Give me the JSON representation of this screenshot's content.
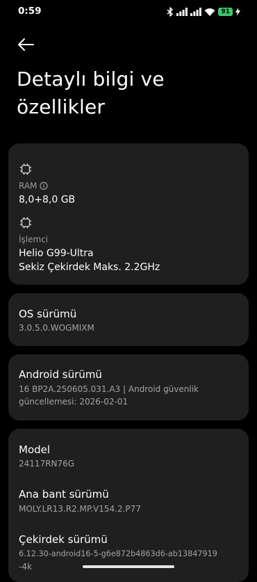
{
  "status_bar": {
    "time": "0:59",
    "battery": "91",
    "icons": [
      "bluetooth-icon",
      "signal-icon",
      "signal-icon",
      "wifi-icon",
      "battery-icon",
      "charging-icon"
    ]
  },
  "header": {
    "back_icon": "arrow-left-icon",
    "title": "Detaylı bilgi ve özellikler"
  },
  "hardware_card": {
    "ram": {
      "icon": "chip-icon",
      "label": "RAM",
      "info_icon": "info-icon",
      "value": "8,0+8,0 GB"
    },
    "processor": {
      "icon": "chip-icon",
      "label": "İşlemci",
      "value_line1": "Helio G99-Ultra",
      "value_line2": "Sekiz Çekirdek Maks. 2.2GHz"
    }
  },
  "os_card": {
    "title": "OS sürümü",
    "value": "3.0.5.0.WOGMIXM"
  },
  "android_card": {
    "title": "Android sürümü",
    "value_line1": "16 BP2A.250605.031.A3 | Android güvenlik",
    "value_line2": "güncellemesi: 2026-02-01"
  },
  "device_card": {
    "model": {
      "title": "Model",
      "value": "24117RN76G"
    },
    "baseband": {
      "title": "Ana bant sürümü",
      "value": "MOLY.LR13.R2.MP.V154.2.P77"
    },
    "kernel": {
      "title": "Çekirdek sürümü",
      "value_line1": "6.12.30-android16-5-g6e872b4863d6-ab13847919",
      "value_line2": "-4k"
    }
  },
  "colors": {
    "background": "#000000",
    "card": "#1f1f1f",
    "battery": "#39c86a",
    "secondary_text": "#a3a3a3"
  }
}
